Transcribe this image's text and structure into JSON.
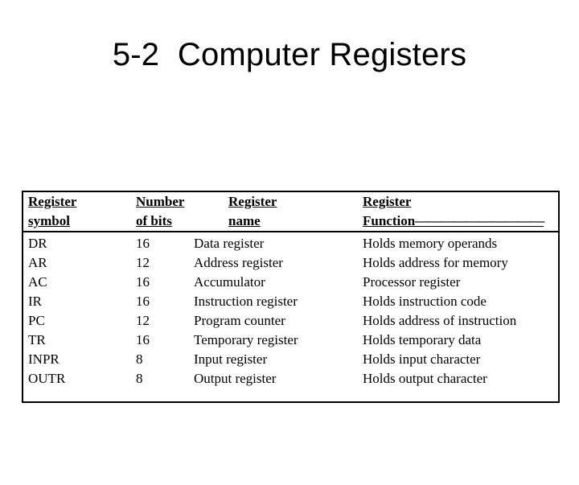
{
  "slide": {
    "title": "5-2  Computer Registers"
  },
  "table": {
    "headers": {
      "symbol_line1": "Register",
      "symbol_line2": "symbol",
      "bits_line1": "Number",
      "bits_line1_mark": "_",
      "bits_line2": "of bits",
      "name_line1": "Register",
      "name_line2": "name",
      "function_line1": "Register",
      "function_line2": "Function",
      "function_dashes": "——————————"
    },
    "rows": [
      {
        "symbol": "DR",
        "bits": "16",
        "name": "Data register",
        "function": "Holds memory operands"
      },
      {
        "symbol": "AR",
        "bits": "12",
        "name": "Address register",
        "function": "Holds address for memory"
      },
      {
        "symbol": "AC",
        "bits": "16",
        "name": "Accumulator",
        "function": "Processor register"
      },
      {
        "symbol": "IR",
        "bits": "16",
        "name": "Instruction register",
        "function": "Holds instruction code"
      },
      {
        "symbol": "PC",
        "bits": "12",
        "name": "Program counter",
        "function": "Holds address of instruction"
      },
      {
        "symbol": "TR",
        "bits": "16",
        "name": "Temporary register",
        "function": "Holds temporary data"
      },
      {
        "symbol": "INPR",
        "bits": "8",
        "name": "Input register",
        "function": "Holds input character"
      },
      {
        "symbol": "OUTR",
        "bits": "8",
        "name": "Output register",
        "function": "Holds output character"
      }
    ]
  },
  "colors": {
    "background": "#ffffff",
    "text": "#000000",
    "border": "#000000"
  }
}
